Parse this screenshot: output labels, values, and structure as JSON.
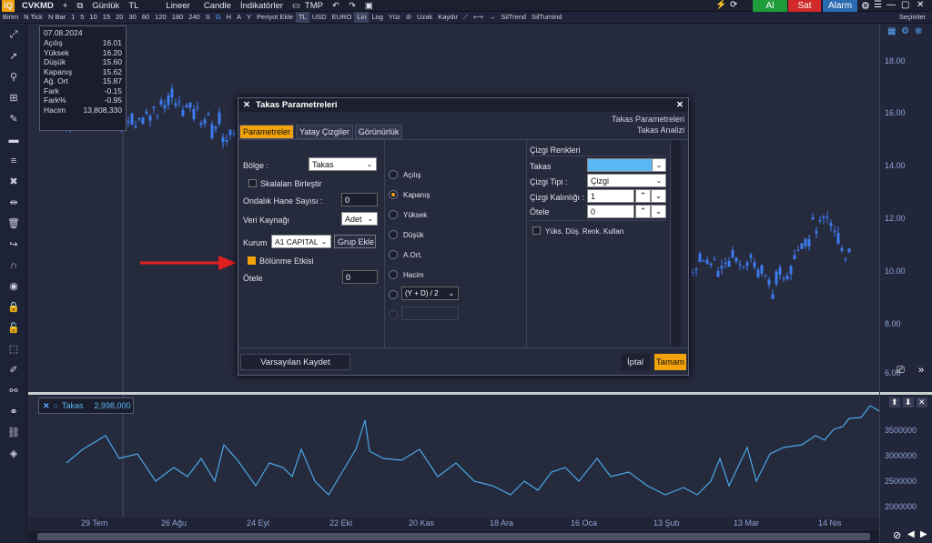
{
  "topbar": {
    "symbol": "CVKMD",
    "plus": "+",
    "period": "Günlük",
    "currency": "TL",
    "scale": "Lineer",
    "chart_type": "Candle",
    "indicators": "İndikatörler",
    "tmp": "TMP",
    "buy": "Al",
    "sell": "Sat",
    "alarm": "Alarm"
  },
  "toolbar": {
    "items": [
      "Birim",
      "N Tick",
      "N Bar",
      "1",
      "5",
      "10",
      "15",
      "20",
      "30",
      "60",
      "120",
      "180",
      "240",
      "S",
      "G",
      "H",
      "A",
      "Y",
      "Periyot Ekle",
      "TL",
      "USD",
      "EURO",
      "Lin",
      "Log",
      "Yüz",
      "Uzak",
      "Kaydır",
      "SilTrend",
      "SilTumInd"
    ],
    "selections": "Seçimler"
  },
  "infobox": {
    "date": "07.08.2024",
    "rows": [
      {
        "k": "Açılış",
        "v": "16.01"
      },
      {
        "k": "Yüksek",
        "v": "16.20"
      },
      {
        "k": "Düşük",
        "v": "15.60"
      },
      {
        "k": "Kapanış",
        "v": "15.62"
      },
      {
        "k": "Ağ. Ort",
        "v": "15.87"
      },
      {
        "k": "Fark",
        "v": "-0.15"
      },
      {
        "k": "Fark%",
        "v": "-0.95"
      },
      {
        "k": "Hacim",
        "v": "13,808,330"
      }
    ]
  },
  "price_axis": [
    "18.00",
    "16.00",
    "14.00",
    "12.00",
    "10.00",
    "8.00",
    "6.00"
  ],
  "volume_axis": [
    "3500000",
    "3000000",
    "2500000",
    "2000000"
  ],
  "lower_legend": {
    "name": "Takas",
    "value": "2,998,000"
  },
  "x_axis": [
    "29 Tem",
    "26 Ağu",
    "24 Eyl",
    "22 Eki",
    "20 Kas",
    "18 Ara",
    "16 Oca",
    "13 Şub",
    "13 Mar",
    "14 Nis"
  ],
  "dialog": {
    "title": "Takas Parametreleri",
    "tabs": [
      "Parametreler",
      "Yatay Çizgiler",
      "Görünürlük"
    ],
    "right_title1": "Takas Parametreleri",
    "right_title2": "Takas Analizi",
    "bolge_label": "Bölge :",
    "bolge_value": "Takas",
    "skalalari": "Skalaları Birleştir",
    "ondalik_label": "Ondalık Hane Sayısı :",
    "ondalik_value": "0",
    "veri_label": "Veri Kaynağı",
    "veri_value": "Adet",
    "kurum_label": "Kurum",
    "kurum_value": "A1 CAPITAL",
    "grup_ekle": "Grup Ekle",
    "bolunme": "Bölünme Etkisi",
    "otele_label": "Ötele",
    "otele_value": "0",
    "radios": [
      "Açılış",
      "Kapanış",
      "Yüksek",
      "Düşük",
      "A.Ort.",
      "Hacim"
    ],
    "formula": "(Y + D) / 2",
    "cizgi_renkleri": "Çizgi Renkleri",
    "takas_label": "Takas",
    "takas_color": "#5ab8f5",
    "cizgi_tipi_label": "Çizgi Tipi :",
    "cizgi_tipi_value": "Çizgi",
    "cizgi_kalinlik_label": "Çizgi Kalınlığı :",
    "cizgi_kalinlik_value": "1",
    "otele2_label": "Ötele",
    "otele2_value": "0",
    "yuks_dus": "Yüks. Düş. Renk. Kullan",
    "save_default": "Varsayılan Kaydet",
    "cancel": "İptal",
    "ok": "Tamam"
  }
}
